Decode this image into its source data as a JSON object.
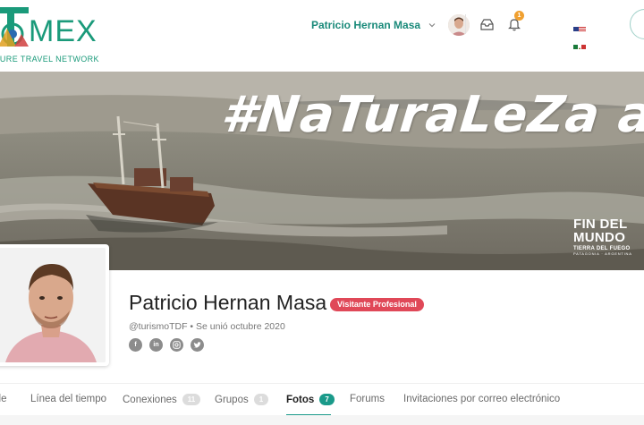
{
  "header": {
    "logo_text": "MEX",
    "logo_tagline": "TURE TRAVEL NETWORK",
    "user_name": "Patricio Hernan Masa",
    "notification_count": "1"
  },
  "colors": {
    "brand": "#1a9a7a",
    "badge": "#e04858",
    "notification": "#f0a030",
    "active_tab": "#1a9a8a"
  },
  "cover": {
    "hashtag": "#NaTuraLeZa al l",
    "brand_line1": "FIN DEL",
    "brand_line2": "MUNDO",
    "brand_line3": "TIERRA DEL FUEGO",
    "brand_line4": "PATAGONIA · ARGENTINA"
  },
  "profile": {
    "name": "Patricio Hernan Masa",
    "badge": "Visitante Profesional",
    "meta": "@turismoTDF • Se unió octubre 2020",
    "socials": [
      "facebook-icon",
      "linkedin-icon",
      "instagram-icon",
      "twitter-icon"
    ]
  },
  "tabs": [
    {
      "label": "ile",
      "count": null
    },
    {
      "label": "Línea del tiempo",
      "count": null
    },
    {
      "label": "Conexiones",
      "count": "11"
    },
    {
      "label": "Grupos",
      "count": "1"
    },
    {
      "label": "Fotos",
      "count": "7"
    },
    {
      "label": "Forums",
      "count": null
    },
    {
      "label": "Invitaciones por correo electrónico",
      "count": null
    }
  ],
  "active_tab": "Fotos"
}
